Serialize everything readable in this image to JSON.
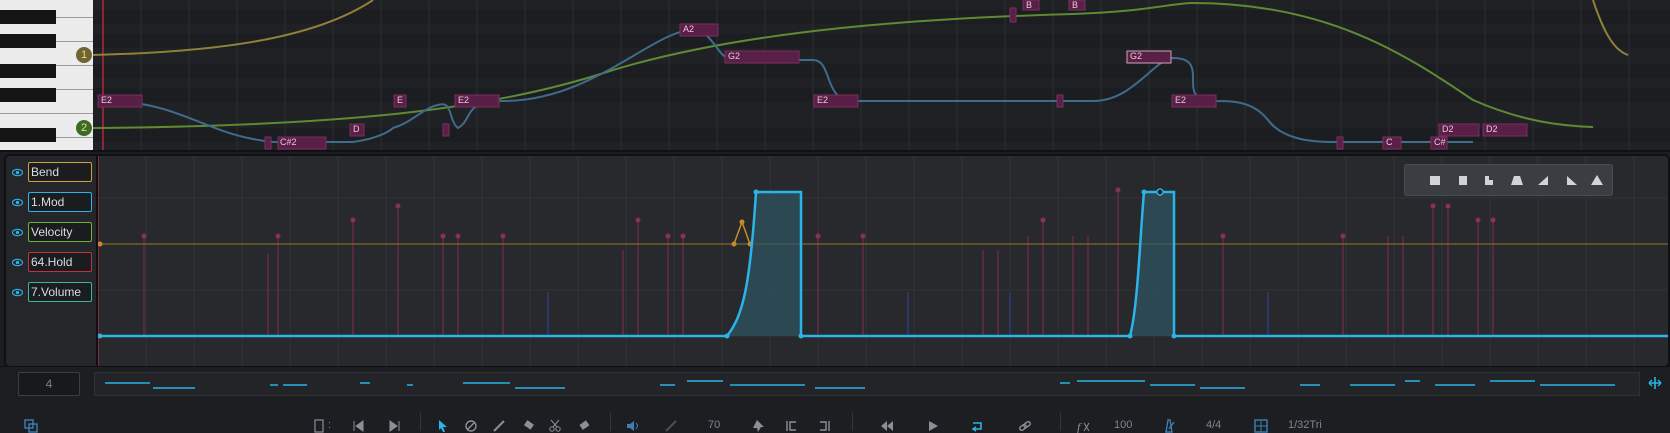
{
  "piano_roll": {
    "markers": [
      "1",
      "2"
    ],
    "notes": [
      "E2",
      "C#2",
      "D",
      "E",
      "E2",
      "A2",
      "G2",
      "E2",
      "B",
      "B",
      "G2",
      "E2",
      "C",
      "C#",
      "D2",
      "D2"
    ]
  },
  "automation": {
    "lanes": [
      {
        "label": "Bend",
        "color": "#c9a53a"
      },
      {
        "label": "1.Mod",
        "color": "#2ab4e8"
      },
      {
        "label": "Velocity",
        "color": "#6fb23a"
      },
      {
        "label": "64.Hold",
        "color": "#c2323a"
      },
      {
        "label": "7.Volume",
        "color": "#36b8a0"
      }
    ],
    "shape_buttons": [
      "square-icon",
      "square-half-icon",
      "step-icon",
      "trapezoid-icon",
      "ramp-up-icon",
      "ramp-down-icon",
      "triangle-icon"
    ]
  },
  "overview": {
    "value": "4"
  },
  "toolbar": {
    "velocity": "70",
    "tempo_pct": "100",
    "time_signature": "4/4",
    "grid": "1/32Tri"
  },
  "colors": {
    "accent": "#2ab4e8",
    "note_fill": "#5a1f47",
    "velocity_line": "#6a9a38",
    "bend_line": "#9a8a3e"
  }
}
